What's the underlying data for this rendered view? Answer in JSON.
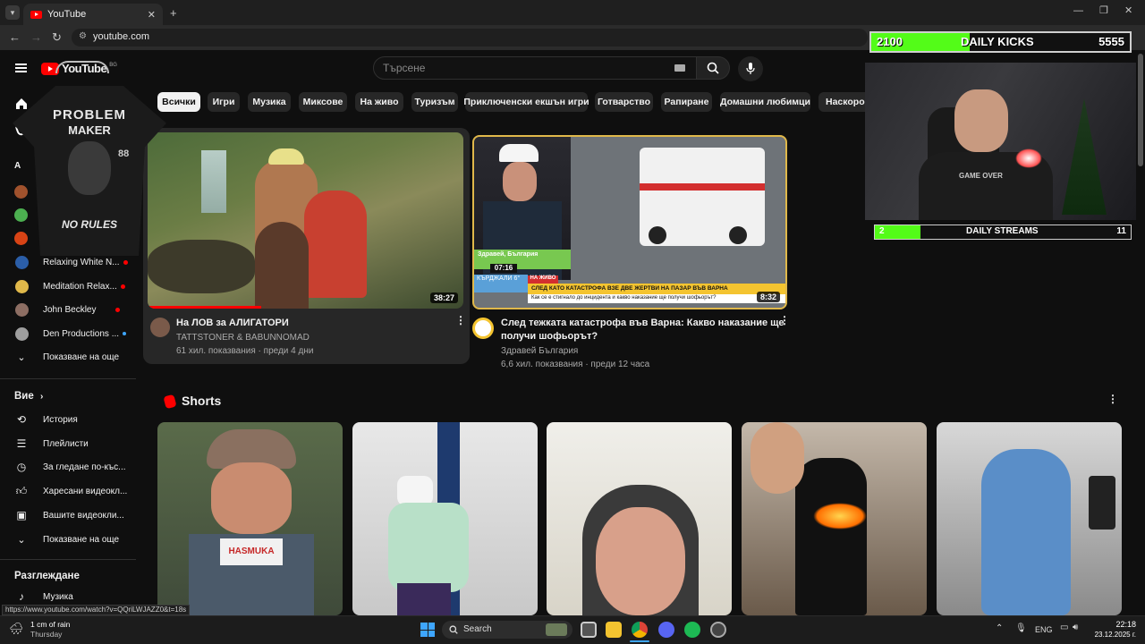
{
  "browser": {
    "tab_title": "YouTube",
    "url": "youtube.com"
  },
  "youtube": {
    "logo_text": "YouTube",
    "region_badge": "BG",
    "search_placeholder": "Търсене"
  },
  "chips": [
    "Всички",
    "Игри",
    "Музика",
    "Миксове",
    "На живо",
    "Туризъм",
    "Приключенски екшън игри",
    "Готварство",
    "Рапиране",
    "Домашни любимци",
    "Наскоро к"
  ],
  "sidebar": {
    "subscriptions": [
      {
        "label": "Relaxing White N...",
        "dot": "#ff0000",
        "avatar": "#2b5ea8"
      },
      {
        "label": "Meditation Relax...",
        "dot": "#ff0000",
        "avatar": "#4caf50"
      },
      {
        "label": "John Beckley",
        "dot": "#ff0000",
        "avatar": "#8d6e63"
      },
      {
        "label": "Den Productions ...",
        "dot": "#3ea6ff",
        "avatar": "#9e9e9e"
      }
    ],
    "show_more_1": "Показване на още",
    "you_heading": "Вие",
    "you_items": [
      "История",
      "Плейлисти",
      "За гледане по-къс...",
      "Харесани видеокл...",
      "Вашите видеокли..."
    ],
    "show_more_2": "Показване на още",
    "explore_heading": "Разглеждане",
    "explore_items": [
      "Музика"
    ]
  },
  "videos": [
    {
      "title": "На ЛОВ за АЛИГАТОРИ",
      "channel": "TATTSTONER & BABUNNOMAD",
      "meta": "61 хил. показвания · преди 4 дни",
      "duration": "38:27"
    },
    {
      "title_line1": "След тежката катастрофа във Варна: Какво наказание ще",
      "title_line2": "получи шофьорът?",
      "channel": "Здравей България",
      "meta": "6,6 хил. показвания · преди 12 часа",
      "duration": "8:32",
      "thumb_caption": "СЛЕД КАТО КАТАСТРОФА ВЗЕ ДВЕ ЖЕРТВИ НА ПАЗАР ВЪВ ВАРНА",
      "thumb_sub": "Как се е стигнало до инцидента и какво наказание ще получи шофьорът?",
      "thumb_time": "07:16",
      "thumb_live": "НА ЖИВО",
      "thumb_show": "Здравей, България",
      "thumb_weather": "6°",
      "thumb_city": "КЪРДЖАЛИ"
    }
  ],
  "shorts_heading": "Shorts",
  "shorts_texts": {
    "hat_text": "HASMUKA"
  },
  "overlay": {
    "top_left_number": "2100",
    "top_label": "DAILY KICKS",
    "top_right_number": "5555",
    "top_progress": 0.38,
    "bottom_left_number": "2",
    "bottom_label": "DAILY STREAMS",
    "bottom_right_number": "11",
    "bottom_progress": 0.18,
    "shirt_text_1": "PROBLEM",
    "shirt_text_2": "MAKER",
    "shirt_text_3": "88",
    "shirt_text_4": "NO RULES",
    "shirt_text_5": "GAME OVER"
  },
  "status_url": "https://www.youtube.com/watch?v=QQriLWJAZZ0&t=18s",
  "taskbar": {
    "weather_line1": "1 cm of rain",
    "weather_line2": "Thursday",
    "search_label": "Search",
    "lang": "ENG",
    "time": "22:18",
    "date": "23.12.2025 г."
  },
  "colors": {
    "accent": "#ff0000",
    "progress_green": "#53fc18",
    "yt_bg": "#0f0f0f"
  }
}
